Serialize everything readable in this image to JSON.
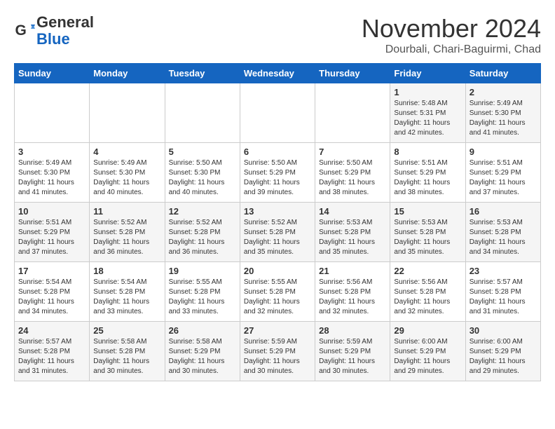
{
  "header": {
    "logo_line1": "General",
    "logo_line2": "Blue",
    "month_title": "November 2024",
    "location": "Dourbali, Chari-Baguirmi, Chad"
  },
  "days_of_week": [
    "Sunday",
    "Monday",
    "Tuesday",
    "Wednesday",
    "Thursday",
    "Friday",
    "Saturday"
  ],
  "weeks": [
    [
      {
        "day": "",
        "info": ""
      },
      {
        "day": "",
        "info": ""
      },
      {
        "day": "",
        "info": ""
      },
      {
        "day": "",
        "info": ""
      },
      {
        "day": "",
        "info": ""
      },
      {
        "day": "1",
        "info": "Sunrise: 5:48 AM\nSunset: 5:31 PM\nDaylight: 11 hours and 42 minutes."
      },
      {
        "day": "2",
        "info": "Sunrise: 5:49 AM\nSunset: 5:30 PM\nDaylight: 11 hours and 41 minutes."
      }
    ],
    [
      {
        "day": "3",
        "info": "Sunrise: 5:49 AM\nSunset: 5:30 PM\nDaylight: 11 hours and 41 minutes."
      },
      {
        "day": "4",
        "info": "Sunrise: 5:49 AM\nSunset: 5:30 PM\nDaylight: 11 hours and 40 minutes."
      },
      {
        "day": "5",
        "info": "Sunrise: 5:50 AM\nSunset: 5:30 PM\nDaylight: 11 hours and 40 minutes."
      },
      {
        "day": "6",
        "info": "Sunrise: 5:50 AM\nSunset: 5:29 PM\nDaylight: 11 hours and 39 minutes."
      },
      {
        "day": "7",
        "info": "Sunrise: 5:50 AM\nSunset: 5:29 PM\nDaylight: 11 hours and 38 minutes."
      },
      {
        "day": "8",
        "info": "Sunrise: 5:51 AM\nSunset: 5:29 PM\nDaylight: 11 hours and 38 minutes."
      },
      {
        "day": "9",
        "info": "Sunrise: 5:51 AM\nSunset: 5:29 PM\nDaylight: 11 hours and 37 minutes."
      }
    ],
    [
      {
        "day": "10",
        "info": "Sunrise: 5:51 AM\nSunset: 5:29 PM\nDaylight: 11 hours and 37 minutes."
      },
      {
        "day": "11",
        "info": "Sunrise: 5:52 AM\nSunset: 5:28 PM\nDaylight: 11 hours and 36 minutes."
      },
      {
        "day": "12",
        "info": "Sunrise: 5:52 AM\nSunset: 5:28 PM\nDaylight: 11 hours and 36 minutes."
      },
      {
        "day": "13",
        "info": "Sunrise: 5:52 AM\nSunset: 5:28 PM\nDaylight: 11 hours and 35 minutes."
      },
      {
        "day": "14",
        "info": "Sunrise: 5:53 AM\nSunset: 5:28 PM\nDaylight: 11 hours and 35 minutes."
      },
      {
        "day": "15",
        "info": "Sunrise: 5:53 AM\nSunset: 5:28 PM\nDaylight: 11 hours and 35 minutes."
      },
      {
        "day": "16",
        "info": "Sunrise: 5:53 AM\nSunset: 5:28 PM\nDaylight: 11 hours and 34 minutes."
      }
    ],
    [
      {
        "day": "17",
        "info": "Sunrise: 5:54 AM\nSunset: 5:28 PM\nDaylight: 11 hours and 34 minutes."
      },
      {
        "day": "18",
        "info": "Sunrise: 5:54 AM\nSunset: 5:28 PM\nDaylight: 11 hours and 33 minutes."
      },
      {
        "day": "19",
        "info": "Sunrise: 5:55 AM\nSunset: 5:28 PM\nDaylight: 11 hours and 33 minutes."
      },
      {
        "day": "20",
        "info": "Sunrise: 5:55 AM\nSunset: 5:28 PM\nDaylight: 11 hours and 32 minutes."
      },
      {
        "day": "21",
        "info": "Sunrise: 5:56 AM\nSunset: 5:28 PM\nDaylight: 11 hours and 32 minutes."
      },
      {
        "day": "22",
        "info": "Sunrise: 5:56 AM\nSunset: 5:28 PM\nDaylight: 11 hours and 32 minutes."
      },
      {
        "day": "23",
        "info": "Sunrise: 5:57 AM\nSunset: 5:28 PM\nDaylight: 11 hours and 31 minutes."
      }
    ],
    [
      {
        "day": "24",
        "info": "Sunrise: 5:57 AM\nSunset: 5:28 PM\nDaylight: 11 hours and 31 minutes."
      },
      {
        "day": "25",
        "info": "Sunrise: 5:58 AM\nSunset: 5:28 PM\nDaylight: 11 hours and 30 minutes."
      },
      {
        "day": "26",
        "info": "Sunrise: 5:58 AM\nSunset: 5:29 PM\nDaylight: 11 hours and 30 minutes."
      },
      {
        "day": "27",
        "info": "Sunrise: 5:59 AM\nSunset: 5:29 PM\nDaylight: 11 hours and 30 minutes."
      },
      {
        "day": "28",
        "info": "Sunrise: 5:59 AM\nSunset: 5:29 PM\nDaylight: 11 hours and 30 minutes."
      },
      {
        "day": "29",
        "info": "Sunrise: 6:00 AM\nSunset: 5:29 PM\nDaylight: 11 hours and 29 minutes."
      },
      {
        "day": "30",
        "info": "Sunrise: 6:00 AM\nSunset: 5:29 PM\nDaylight: 11 hours and 29 minutes."
      }
    ]
  ]
}
